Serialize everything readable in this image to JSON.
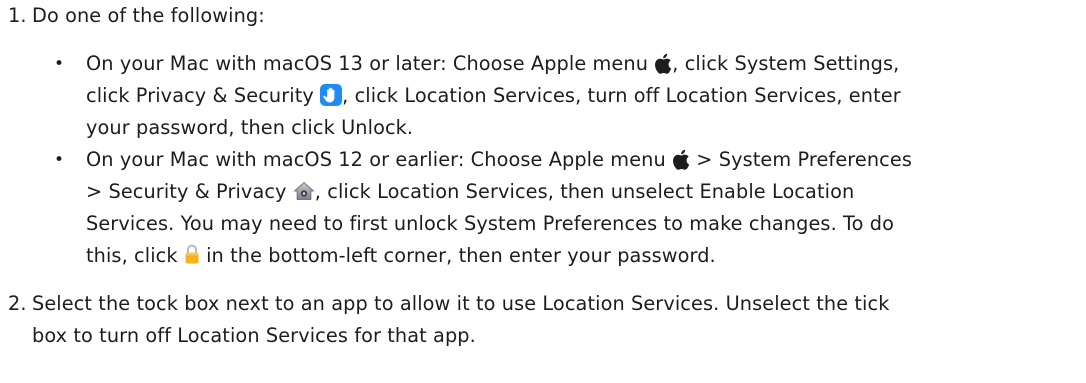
{
  "steps": [
    {
      "number": "1.",
      "text": "Do one of the following:",
      "bullets": [
        {
          "lines": [
            {
              "a": "On your Mac with macOS 13 or later: Choose Apple menu ",
              "b": ", click System Settings,"
            },
            {
              "a": "click Privacy & Security ",
              "b": ", click Location Services, turn off Location Services, enter"
            },
            {
              "a": "your password, then click Unlock."
            }
          ]
        },
        {
          "lines": [
            {
              "a": "On your Mac with macOS 12 or earlier: Choose Apple menu ",
              "b": " > System Preferences"
            },
            {
              "a": "> Security & Privacy ",
              "b": ", click Location Services, then unselect Enable Location"
            },
            {
              "a": "Services. You may need to first unlock System Preferences to make changes. To do"
            },
            {
              "a": "this, click ",
              "b": " in the bottom-left corner, then enter your password."
            }
          ]
        }
      ]
    },
    {
      "number": "2.",
      "lines": [
        "Select the tock box next to an app to allow it to use Location Services. Unselect the tick",
        "box to turn off Location Services for that app."
      ]
    }
  ],
  "icons": {
    "apple": "apple-icon",
    "privacy": "privacy-hand-icon",
    "security_privacy": "security-privacy-house-icon",
    "lock": "lock-icon"
  },
  "colors": {
    "text": "#1d1d1f",
    "privacy_icon_bg": "#1f8bf5",
    "lock_color": "#f5b21b"
  }
}
